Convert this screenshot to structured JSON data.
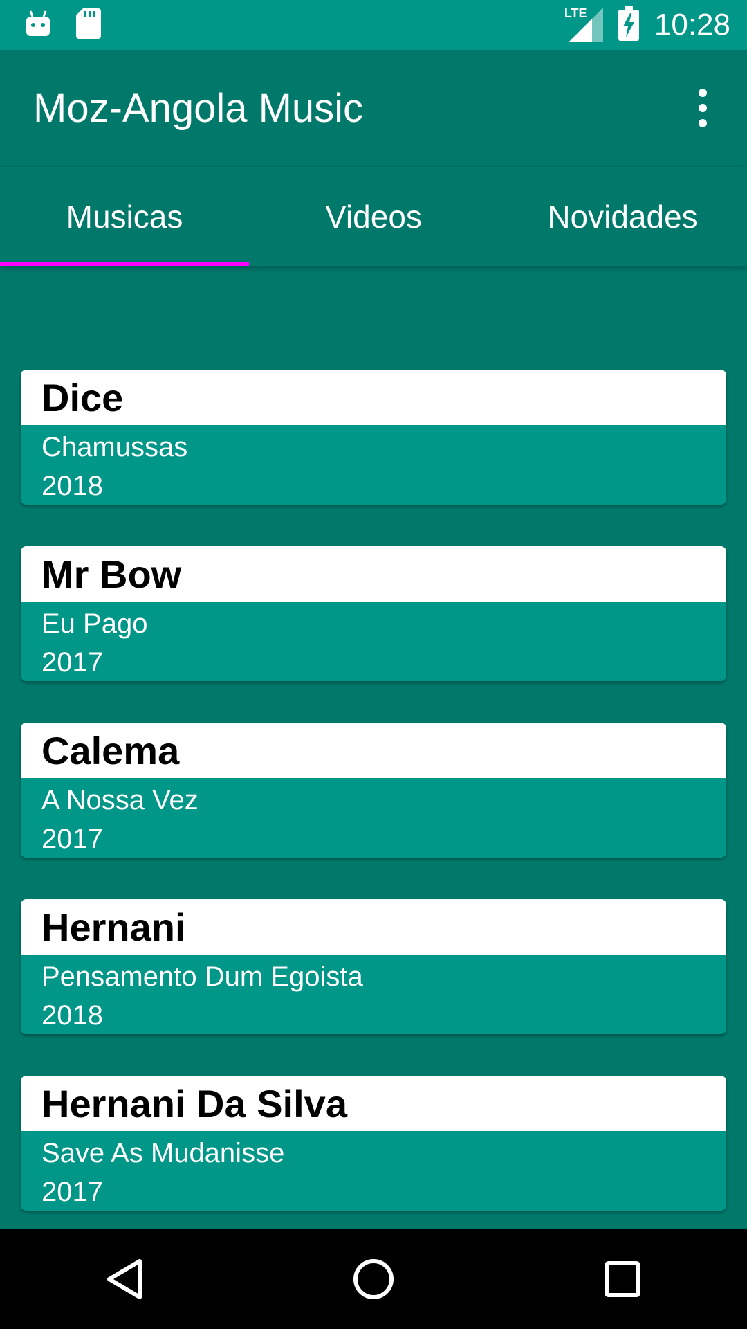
{
  "status_bar": {
    "time": "10:28",
    "network": "LTE",
    "icons": [
      "android-icon",
      "sd-card-icon",
      "signal-icon",
      "battery-charging-icon"
    ]
  },
  "app_bar": {
    "title": "Moz-Angola Music",
    "menu_icon": "more-vert-icon"
  },
  "tabs": [
    {
      "label": "Musicas",
      "active": true
    },
    {
      "label": "Videos",
      "active": false
    },
    {
      "label": "Novidades",
      "active": false
    }
  ],
  "songs": [
    {
      "artist": "Dice",
      "title": "Chamussas",
      "year": "2018"
    },
    {
      "artist": "Mr Bow",
      "title": "Eu Pago",
      "year": "2017"
    },
    {
      "artist": "Calema",
      "title": "A Nossa Vez",
      "year": "2017"
    },
    {
      "artist": "Hernani",
      "title": "Pensamento Dum Egoista",
      "year": "2018"
    },
    {
      "artist": "Hernani Da Silva",
      "title": "Save As Mudanisse",
      "year": "2017"
    }
  ],
  "nav_bar": {
    "icons": [
      "back-icon",
      "home-icon",
      "recents-icon"
    ]
  },
  "colors": {
    "primary": "#009688",
    "primary_dark": "#00796b",
    "tab_indicator": "#ff00ff",
    "card_header": "#ffffff"
  }
}
